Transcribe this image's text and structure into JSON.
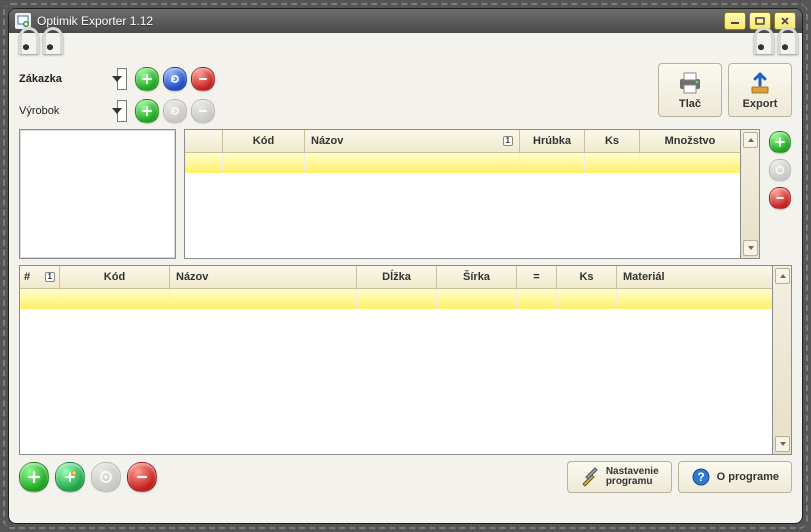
{
  "window": {
    "title": "Optimik Exporter 1.12"
  },
  "labels": {
    "zakazka": "Zákazka",
    "vyrobok": "Výrobok"
  },
  "combos": {
    "zakazka_value": "",
    "vyrobok_value": ""
  },
  "toolbar": {
    "print": "Tlač",
    "export": "Export"
  },
  "grid_top": {
    "headers": {
      "blank": "",
      "kod": "Kód",
      "nazov": "Názov",
      "hrubka": "Hrúbka",
      "ks": "Ks",
      "mnozstvo": "Množstvo"
    },
    "sort_indicator": "1"
  },
  "grid_bottom": {
    "headers": {
      "num": "#",
      "kod": "Kód",
      "nazov": "Názov",
      "dlzka": "Dĺžka",
      "sirka": "Šírka",
      "eq": "=",
      "ks": "Ks",
      "material": "Materiál"
    },
    "sort_indicator": "1"
  },
  "footer": {
    "settings_line1": "Nastavenie",
    "settings_line2": "programu",
    "about": "O programe"
  },
  "icons": {
    "add": "add-icon",
    "refresh": "refresh-icon",
    "delete": "delete-icon",
    "add_alt": "add-star-icon",
    "world": "globe-icon"
  }
}
